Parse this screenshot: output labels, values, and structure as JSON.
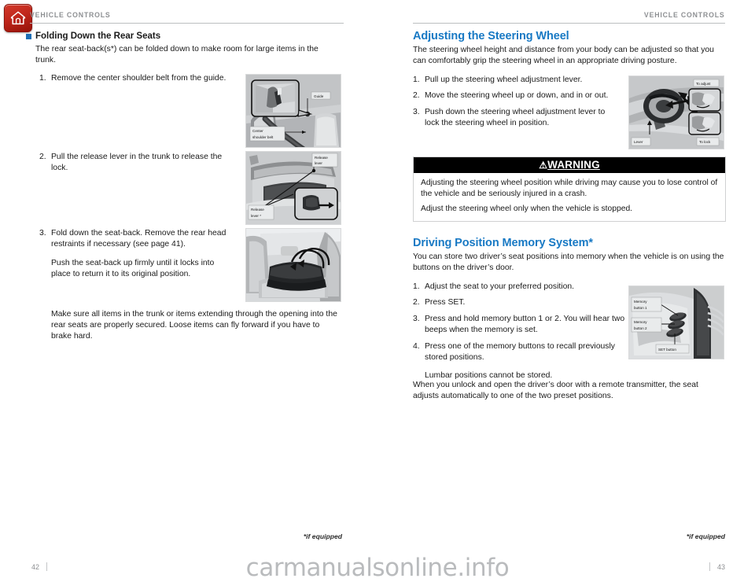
{
  "header": {
    "home_icon": "home-icon",
    "left_running_head": "VEHICLE CONTROLS",
    "right_running_head": "VEHICLE CONTROLS"
  },
  "left_page": {
    "section_heading": "Folding Down the Rear Seats",
    "intro": "The rear seat-back(s*) can be folded down to make room for large items in the trunk.",
    "steps": [
      {
        "num": "1.",
        "text": "Remove the center shoulder belt from the guide."
      },
      {
        "num": "2.",
        "text": "Pull the release lever in the trunk to release the lock."
      },
      {
        "num": "3.",
        "text": "Fold down the seat-back. Remove the rear head restraints if necessary (see page 41)."
      }
    ],
    "step3_extra": "Push the seat-back up firmly until it locks into place to return it to its original position.",
    "closing": "Make sure all items in the trunk or items extending through the opening into the rear seats are properly secured. Loose items can fly forward if you have to brake hard.",
    "figures": [
      {
        "name": "center-shoulder-belt-figure",
        "labels": [
          "Guide",
          "Center",
          "shoulder belt"
        ]
      },
      {
        "name": "trunk-release-lever-figure",
        "labels": [
          "Release",
          "lever",
          "Release",
          "lever *"
        ]
      },
      {
        "name": "folded-seat-back-figure",
        "labels": []
      }
    ],
    "footnote": "*if equipped",
    "page_number": "42"
  },
  "right_page": {
    "heading_1": "Adjusting the Steering Wheel",
    "intro_1": "The steering wheel height and distance from your body can be adjusted so that you can comfortably grip the steering wheel in an appropriate driving posture.",
    "steps_1": [
      {
        "num": "1.",
        "text": "Pull up the steering wheel adjustment lever."
      },
      {
        "num": "2.",
        "text": "Move the steering wheel up or down, and in or out."
      },
      {
        "num": "3.",
        "text": "Push down the steering wheel adjustment lever to lock the steering wheel in position."
      }
    ],
    "figure_1": {
      "name": "steering-wheel-adjust-figure",
      "labels": [
        "To adjust",
        "Lever",
        "To lock"
      ]
    },
    "warning": {
      "title": "WARNING",
      "symbol": "⚠",
      "lines": [
        "Adjusting the steering wheel position while driving may cause you to lose control of the vehicle and be seriously injured in a crash.",
        "Adjust the steering wheel only when the vehicle is stopped."
      ]
    },
    "heading_2": "Driving Position Memory System*",
    "intro_2": "You can store two driver’s seat positions into memory when the vehicle is on using the buttons on the driver’s door.",
    "steps_2": [
      {
        "num": "1.",
        "text": "Adjust the seat to your preferred position."
      },
      {
        "num": "2.",
        "text": "Press SET."
      },
      {
        "num": "3.",
        "text": "Press and hold memory button 1 or 2. You will hear two beeps when the memory is set."
      },
      {
        "num": "4.",
        "text": "Press one of the memory buttons to recall previously stored positions."
      }
    ],
    "step4_extra": "Lumbar positions cannot be stored.",
    "closing_2": "When you unlock and open the driver’s door with a remote transmitter, the seat adjusts automatically to one of the two preset positions.",
    "figure_2": {
      "name": "memory-buttons-figure",
      "labels": [
        "Memory",
        "button 1",
        "Memory",
        "button 2",
        "SET button"
      ]
    },
    "footnote": "*if equipped",
    "page_number": "43"
  },
  "watermark": {
    "text": "carmanualsonline.info"
  },
  "colors": {
    "accent_blue": "#1879c4",
    "bullet_blue": "#1f6fb5",
    "home_red": "#c0271c",
    "rule_gray": "#bcbec0",
    "runhead_gray": "#8e9093"
  }
}
